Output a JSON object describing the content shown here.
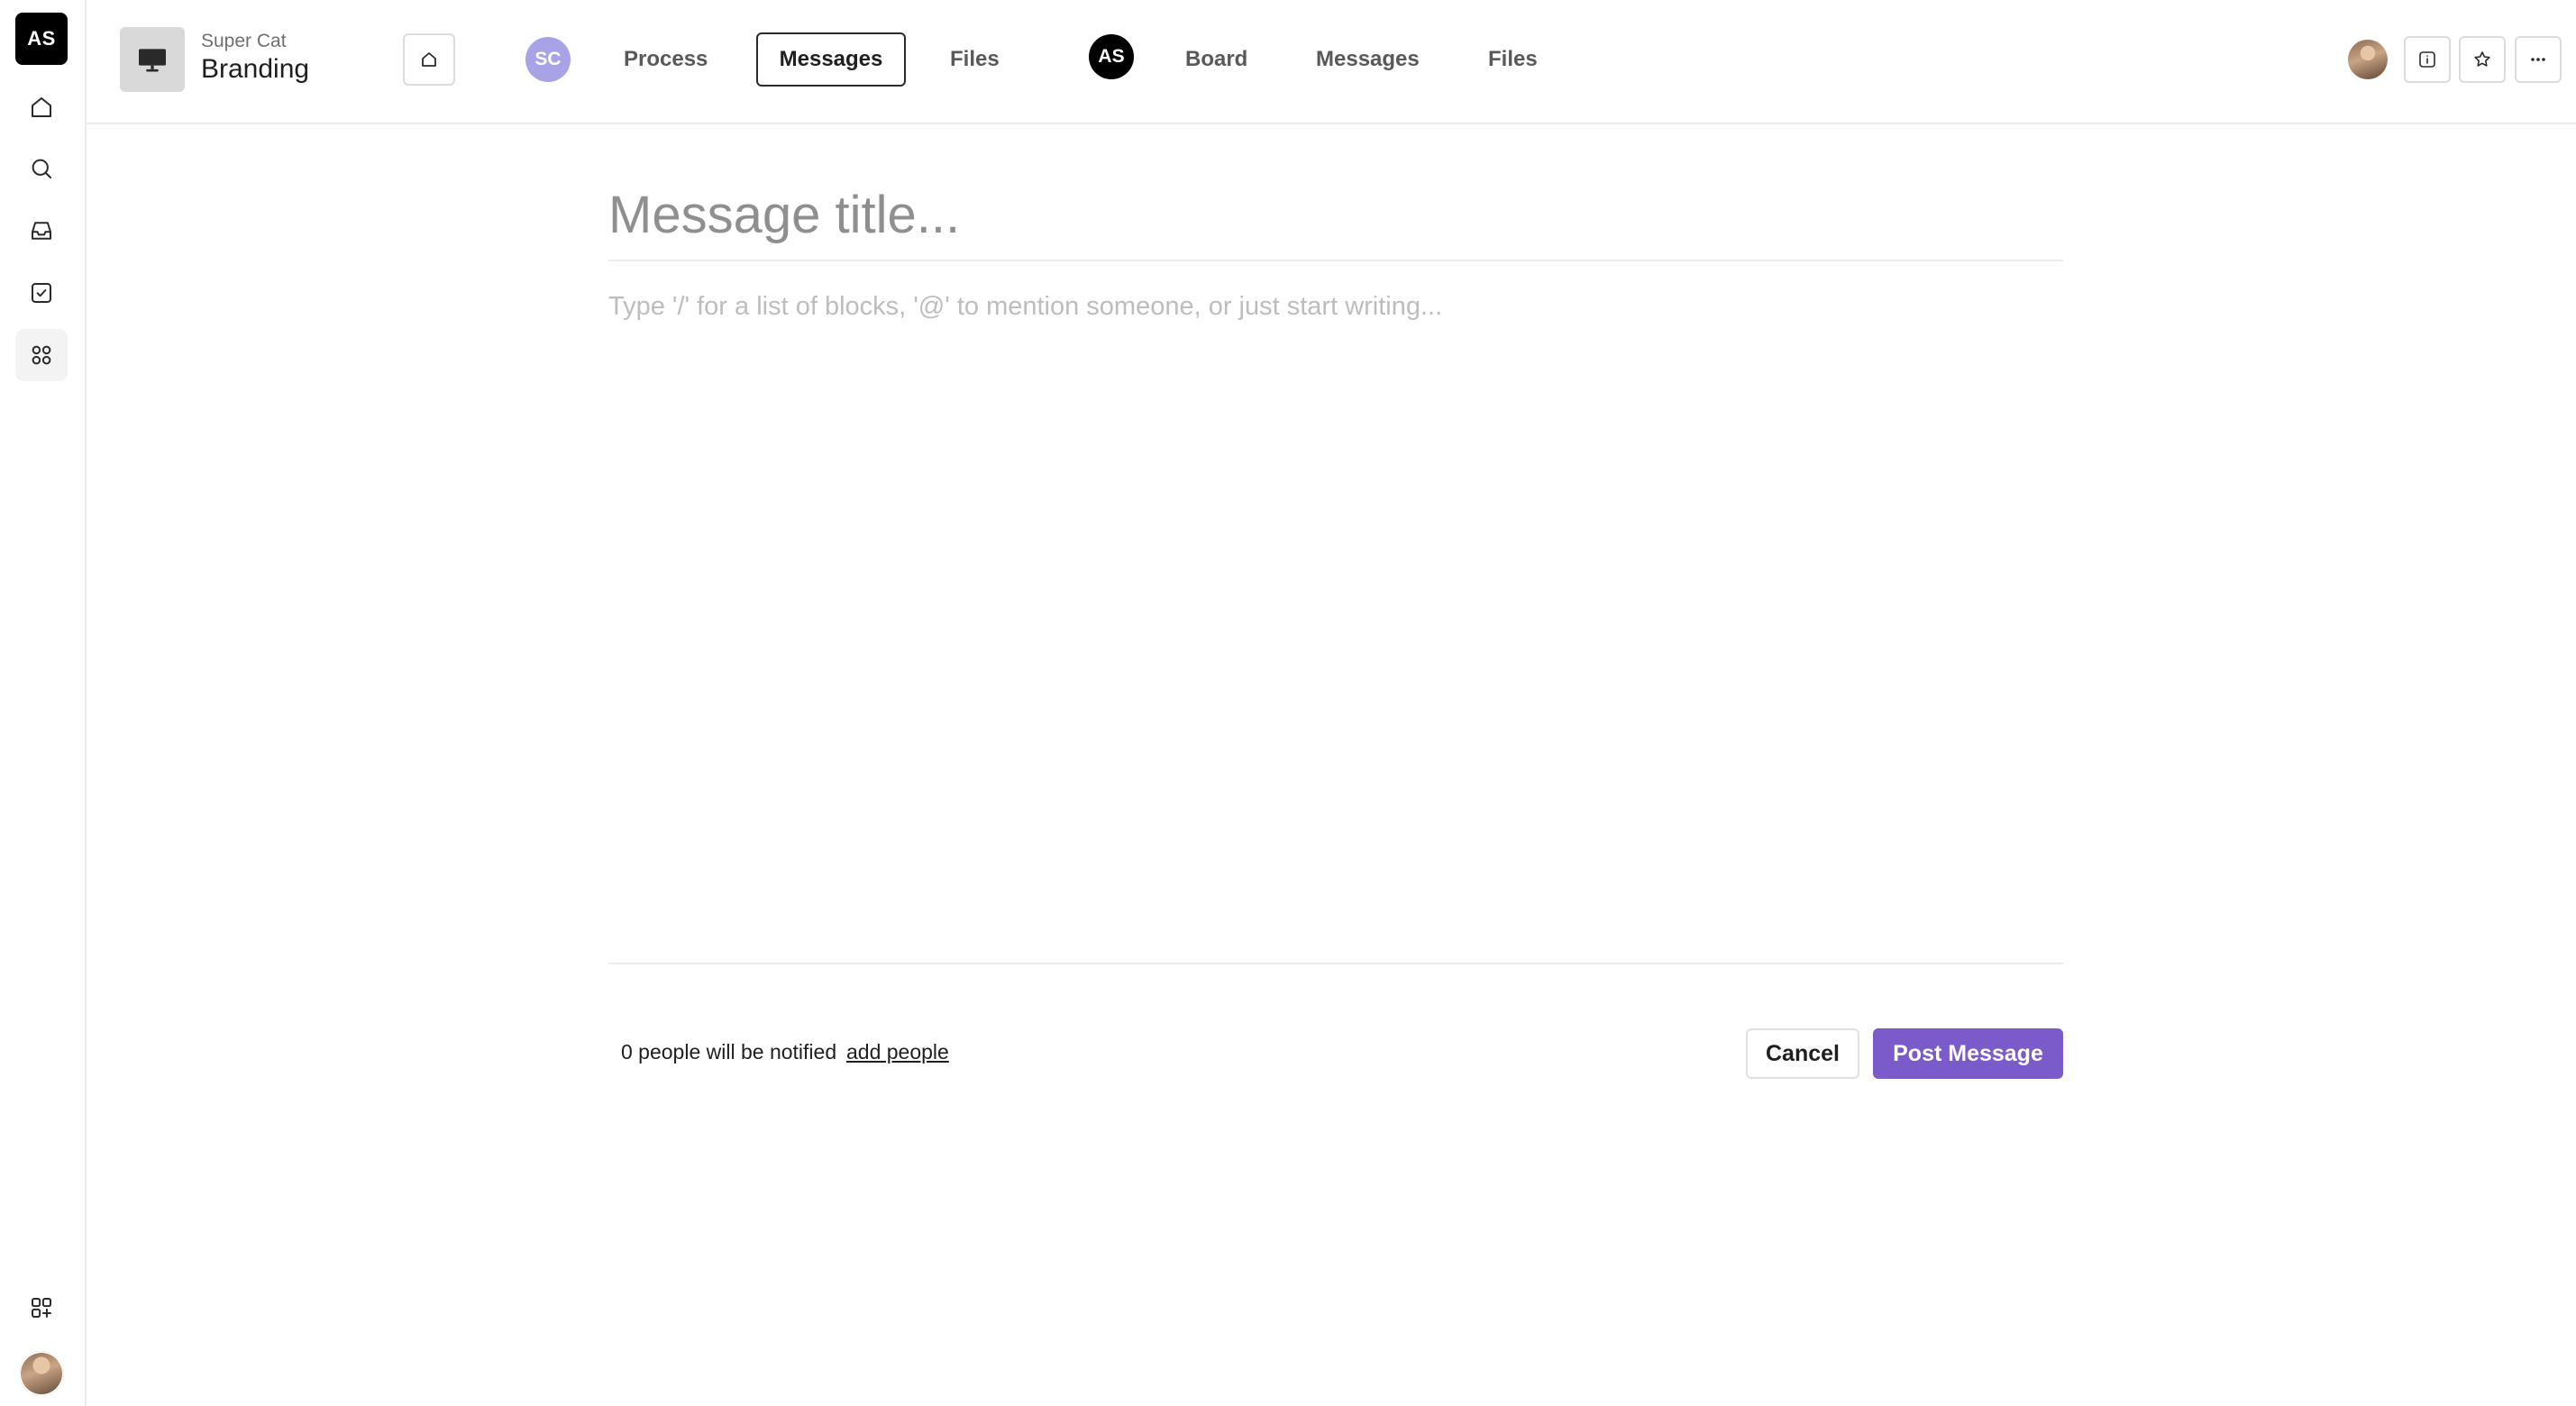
{
  "rail": {
    "workspace_initials": "AS",
    "items": [
      {
        "name": "home-icon"
      },
      {
        "name": "search-icon"
      },
      {
        "name": "inbox-icon"
      },
      {
        "name": "tasks-icon"
      },
      {
        "name": "apps-grid-icon",
        "active": true
      }
    ],
    "bottom": [
      {
        "name": "add-app-icon"
      },
      {
        "name": "user-avatar"
      }
    ]
  },
  "header": {
    "org": "Super Cat",
    "project": "Branding",
    "space1": {
      "initials": "SC",
      "tabs": [
        "Process",
        "Messages",
        "Files"
      ],
      "active_tab": "Messages"
    },
    "space2": {
      "initials": "AS",
      "tabs": [
        "Board",
        "Messages",
        "Files"
      ]
    },
    "right_icons": [
      "info-icon",
      "star-icon",
      "more-icon"
    ]
  },
  "editor": {
    "title_placeholder": "Message title...",
    "body_placeholder": "Type '/' for a list of blocks, '@' to mention someone, or just start writing..."
  },
  "footer": {
    "notify_text": "0 people will be notified",
    "add_people_label": "add people",
    "cancel_label": "Cancel",
    "post_label": "Post Message"
  },
  "colors": {
    "accent": "#7a5bc9",
    "avatar_sc": "#a8a3e6",
    "avatar_as": "#000000"
  }
}
